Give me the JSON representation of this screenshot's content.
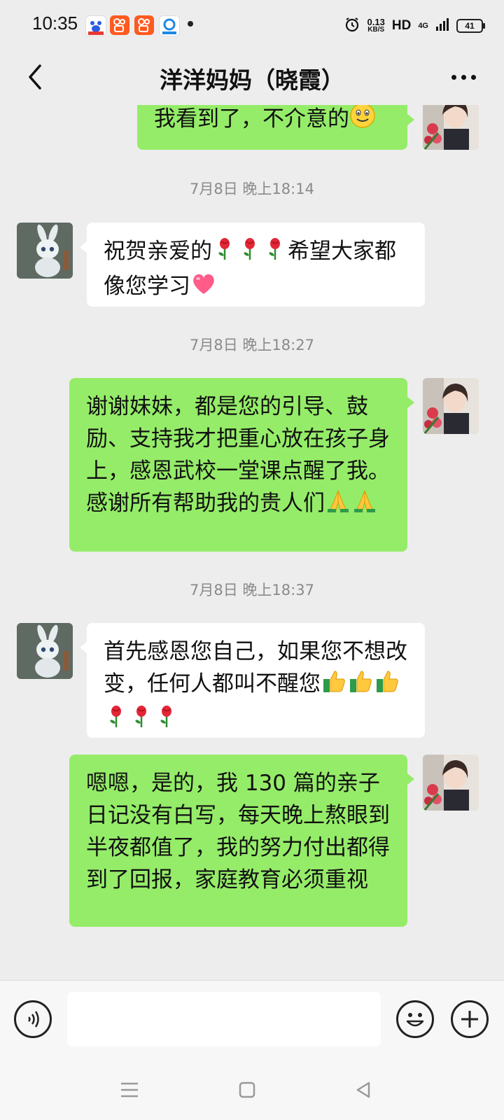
{
  "status_bar": {
    "time": "10:35",
    "speed_value": "0.13",
    "speed_unit": "KB/S",
    "hd": "HD",
    "network": "4G",
    "battery": "41",
    "notif_icons": [
      "baidu-app-icon",
      "kuaishou-app-icon",
      "kuaishou-app-icon",
      "browser-app-icon"
    ],
    "icons": [
      "alarm-icon",
      "signal-icon"
    ]
  },
  "header": {
    "title": "洋洋妈妈（晓霞）",
    "back_icon": "back-arrow-icon",
    "more_icon": "more-dots-icon"
  },
  "messages": [
    {
      "type": "out",
      "text": "我看到了，不介意的",
      "emoji": [
        "smile-emoji"
      ]
    },
    {
      "type": "timestamp",
      "text": "7月8日 晚上18:14"
    },
    {
      "type": "in",
      "text_line1": "祝贺亲爱的",
      "text_line1_end": "希望大家都",
      "text_line2": "像您学习",
      "emoji": [
        "rose-emoji",
        "rose-emoji",
        "rose-emoji",
        "heart-emoji"
      ]
    },
    {
      "type": "timestamp",
      "text": "7月8日 晚上18:27"
    },
    {
      "type": "out",
      "text": "谢谢妹妹，都是您的引导、鼓励、支持我才把重心放在孩子身上，感恩武校一堂课点醒了我。感谢所有帮助我的贵人们",
      "emoji": [
        "pray-emoji",
        "pray-emoji"
      ]
    },
    {
      "type": "timestamp",
      "text": "7月8日 晚上18:37"
    },
    {
      "type": "in",
      "text": "首先感恩您自己，如果您不想改变，任何人都叫不醒您",
      "emoji": [
        "thumbs-up-emoji",
        "thumbs-up-emoji",
        "thumbs-up-emoji",
        "rose-emoji",
        "rose-emoji",
        "rose-emoji"
      ]
    },
    {
      "type": "out",
      "text": "嗯嗯，是的，我 130 篇的亲子日记没有白写，每天晚上熬眼到半夜都值了，我的努力付出都得到了回报，家庭教育必须重视"
    }
  ],
  "input_bar": {
    "value": "",
    "voice_icon": "voice-icon",
    "emoji_icon": "emoji-icon",
    "plus_icon": "plus-icon"
  },
  "nav_bar": {
    "icons": [
      "menu-icon",
      "home-square-icon",
      "back-triangle-icon"
    ]
  },
  "colors": {
    "background": "#ededed",
    "outgoing_bubble": "#95ec69",
    "incoming_bubble": "#ffffff",
    "timestamp": "#8a8a8a"
  }
}
